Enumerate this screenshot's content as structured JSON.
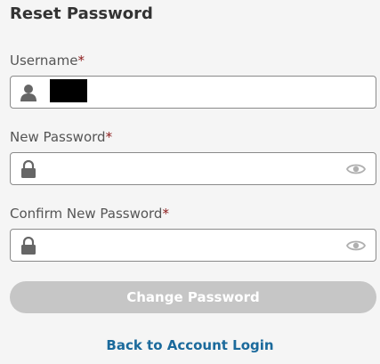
{
  "page": {
    "title": "Reset Password"
  },
  "fields": {
    "username": {
      "label": "Username",
      "required_mark": "*",
      "value_masked": true,
      "icon": "user-icon"
    },
    "new_password": {
      "label": "New Password",
      "required_mark": "*",
      "icon": "lock-icon",
      "toggle_icon": "eye-icon"
    },
    "confirm_password": {
      "label": "Confirm New Password",
      "required_mark": "*",
      "icon": "lock-icon",
      "toggle_icon": "eye-icon"
    }
  },
  "actions": {
    "submit_label": "Change Password",
    "back_link_label": "Back to Account Login"
  },
  "colors": {
    "background": "#f5f5f5",
    "required": "#8b1a1a",
    "button_disabled": "#c6c6c6",
    "link": "#1b6a9c"
  }
}
